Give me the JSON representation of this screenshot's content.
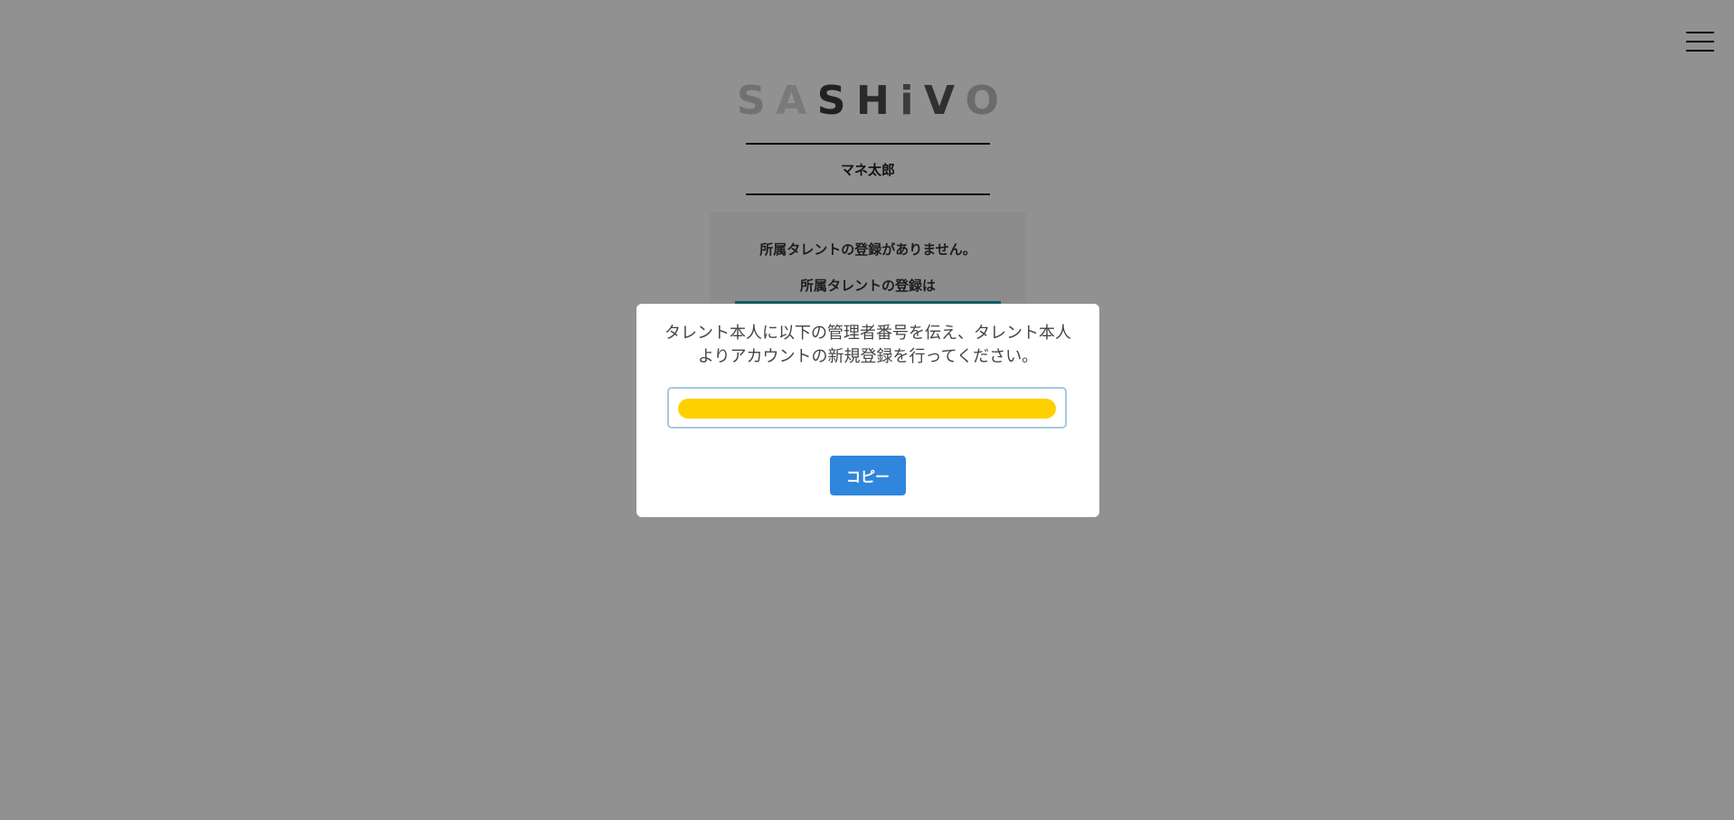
{
  "header": {
    "menu_icon": "hamburger-menu-icon"
  },
  "logo": {
    "letters": [
      "S",
      "A",
      "S",
      "H",
      "i",
      "V",
      "O"
    ],
    "colors": [
      "#c7c7c7",
      "#d6d6d6",
      "#3a3a3a",
      "#4a4a4a",
      "#6a6a6a",
      "#555555",
      "#bdbdbd"
    ]
  },
  "user": {
    "name": "マネ太郎"
  },
  "talent_panel": {
    "empty_message": "所属タレントの登録がありません。",
    "register_prompt": "所属タレントの登録は"
  },
  "modal": {
    "message_line1": "タレント本人に以下の管理者番号を伝え、タレント本人",
    "message_line2": "よりアカウントの新規登録を行ってください。",
    "copy_label": "コピー"
  },
  "colors": {
    "overlay": "rgba(0,0,0,0.43)",
    "copy_button": "#2f86dc",
    "redaction": "#ffd000",
    "accent": "#1ca3b8"
  }
}
